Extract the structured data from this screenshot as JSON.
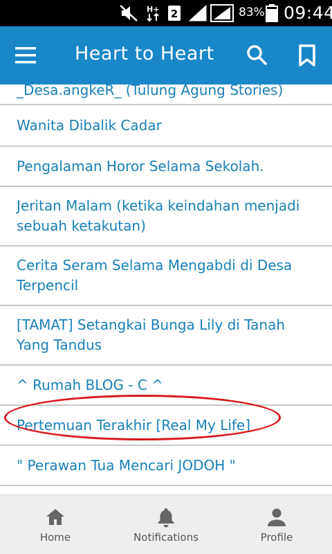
{
  "status_bar": {
    "network_label": "H+",
    "sim_slot": "2",
    "battery_percent": "83%",
    "time": "09:44",
    "icons": [
      "mute-icon",
      "network-type-icon",
      "sim-2-icon",
      "signal-icon",
      "signal-roaming-icon",
      "battery-icon"
    ]
  },
  "app_bar": {
    "title": "Heart to Heart",
    "background_color": "#1a87c9",
    "icons": [
      "menu-icon",
      "search-icon",
      "bookmark-icon"
    ]
  },
  "list": {
    "link_color": "#1a7fb7",
    "items": [
      {
        "label": "_Desa.angkeR_ (Tulung Agung Stories)"
      },
      {
        "label": "Wanita Dibalik Cadar"
      },
      {
        "label": "Pengalaman Horor Selama Sekolah."
      },
      {
        "label": "Jeritan Malam (ketika keindahan menjadi sebuah ketakutan)"
      },
      {
        "label": "Cerita Seram Selama Mengabdi di Desa Terpencil"
      },
      {
        "label": "[TAMAT] Setangkai Bunga Lily di Tanah Yang Tandus"
      },
      {
        "label": "^ Rumah BLOG - C ^"
      },
      {
        "label": "Pertemuan Terakhir [Real My Life]"
      },
      {
        "label": "\" Perawan Tua Mencari JODOH \""
      }
    ],
    "highlighted_index": 7,
    "highlight_color": "#d9181e"
  },
  "bottom_nav": {
    "items": [
      {
        "label": "Home",
        "icon": "home-icon"
      },
      {
        "label": "Notifications",
        "icon": "bell-icon"
      },
      {
        "label": "Profile",
        "icon": "person-icon"
      }
    ]
  }
}
